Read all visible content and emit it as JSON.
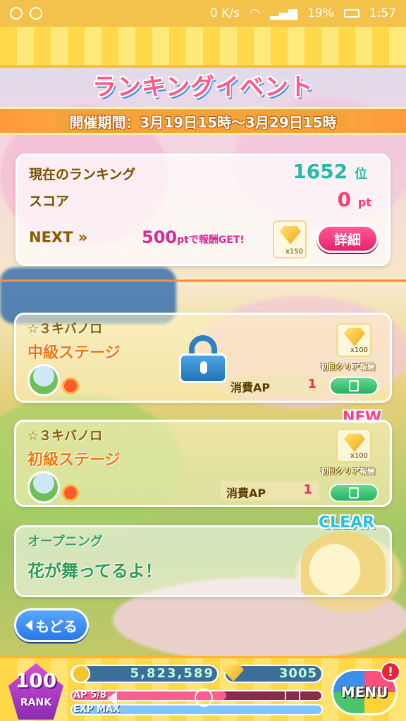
{
  "status_bar": {
    "network_speed": "0 K/s",
    "battery": "19%",
    "time": "1:57"
  },
  "header": {
    "title": "ランキングイベント",
    "period": "開催期間：3月19日15時〜3月29日15時"
  },
  "ranking": {
    "rank_label": "現在のランキング",
    "rank_value": "1652",
    "rank_unit": "位",
    "score_label": "スコア",
    "score_value": "0",
    "score_unit": "pt",
    "next_label": "NEXT »",
    "next_points": "500",
    "next_points_unit": "pt",
    "next_text": "で報酬GET!",
    "reward_count": "x150",
    "detail_button": "詳細"
  },
  "stages": [
    {
      "subtitle": "☆３キバノロ",
      "title": "中級ステージ",
      "ap_label": "消費AP",
      "ap_value": "1",
      "reward_count": "x100",
      "first_clear": "初回クリア報酬",
      "locked": true
    },
    {
      "subtitle": "☆３キバノロ",
      "title": "初級ステージ",
      "ap_label": "消費AP",
      "ap_value": "1",
      "reward_count": "x100",
      "first_clear": "初回クリア報酬",
      "badge": "NEW"
    },
    {
      "subtitle": "オープニング",
      "title": "花が舞ってるよ！",
      "badge": "CLEAR"
    }
  ],
  "back_button": "もどる",
  "player": {
    "rank_number": "100",
    "rank_label": "RANK",
    "money": "5,823,589",
    "gems": "3005",
    "ap_label": "AP 5/8",
    "ap_fraction": 0.62,
    "exp_label": "EXP MAX",
    "exp_fraction": 1.0,
    "menu_button": "MENU",
    "alert": "!"
  }
}
